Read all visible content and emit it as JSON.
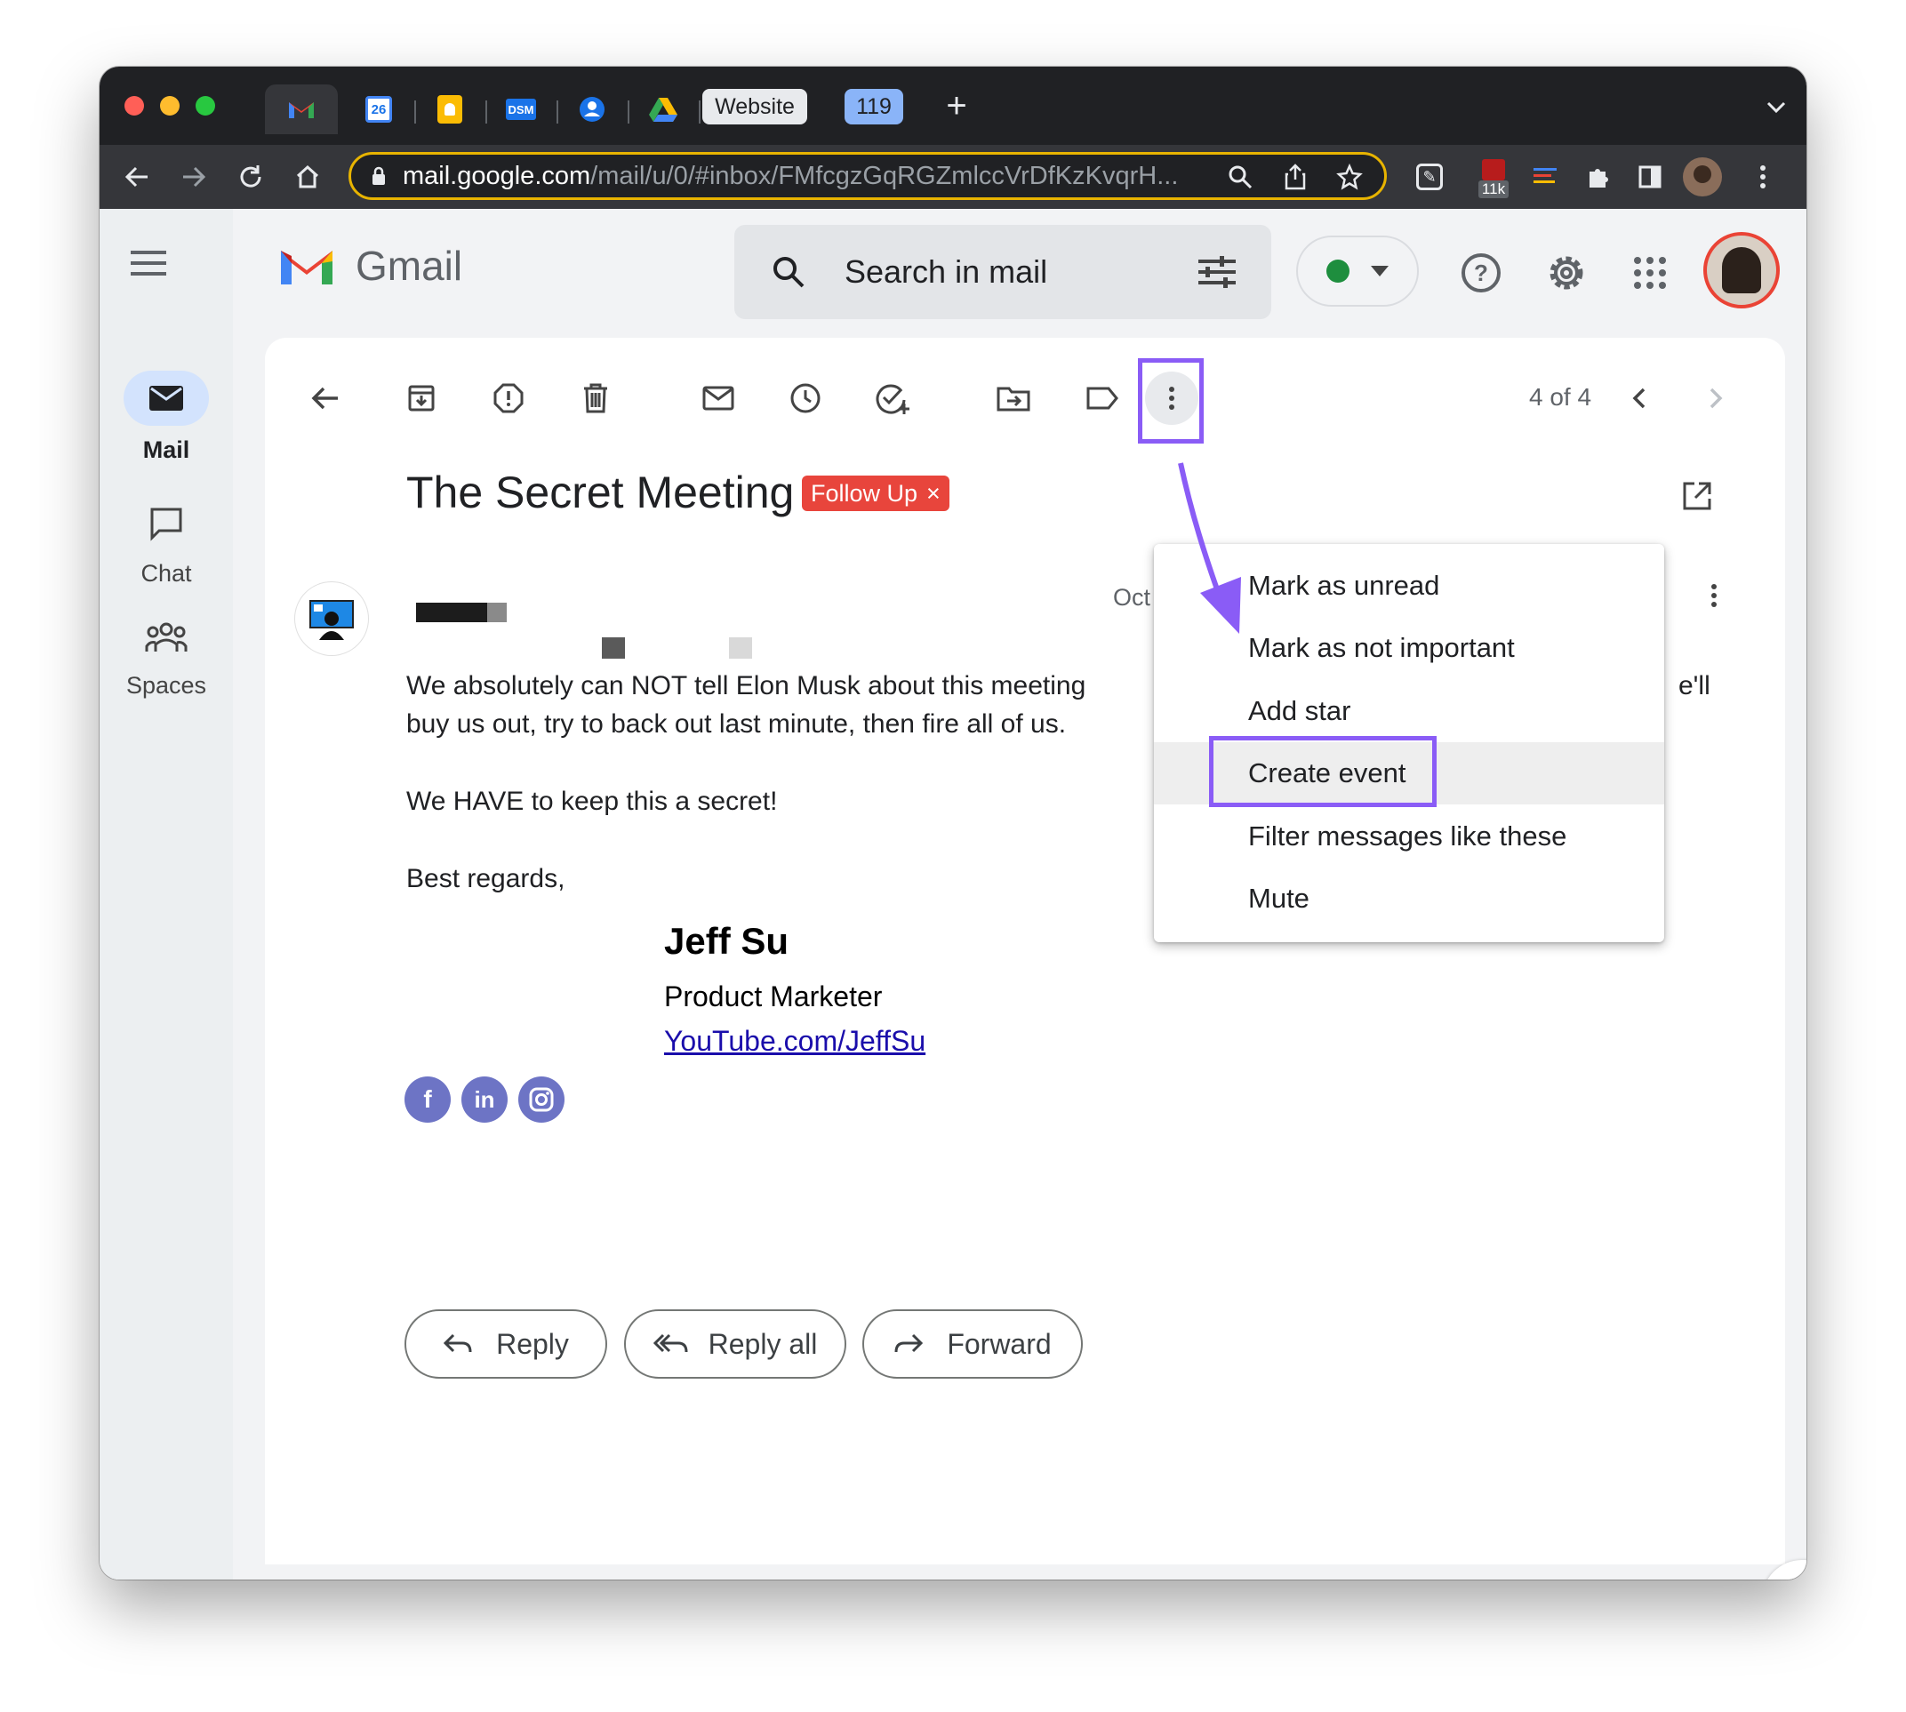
{
  "browser": {
    "tabs": [
      {
        "icon": "gmail-icon"
      },
      {
        "icon": "calendar-icon",
        "label": "26"
      },
      {
        "icon": "keep-icon"
      },
      {
        "icon": "dsm-icon",
        "label": "DSM"
      },
      {
        "icon": "contacts-icon"
      },
      {
        "icon": "drive-icon"
      }
    ],
    "tab_website": "Website",
    "tab_count": "119",
    "url_host": "mail.google.com",
    "url_path": "/mail/u/0/#inbox/FMfcgzGqRGZmlccVrDfKzKvqrH...",
    "ext_badge": "11k"
  },
  "gmail": {
    "logo_text": "Gmail",
    "search_placeholder": "Search in mail",
    "rail": [
      {
        "label": "Mail",
        "icon": "mail-icon"
      },
      {
        "label": "Chat",
        "icon": "chat-icon"
      },
      {
        "label": "Spaces",
        "icon": "spaces-icon"
      }
    ],
    "pagination": "4 of 4",
    "subject": "The Secret Meeting",
    "label_chip": "Follow Up",
    "label_chip_close": "×",
    "date_partial": "Oct",
    "body": [
      "We absolutely can NOT tell Elon Musk about this meeting",
      "buy us out, try to back out last minute, then fire all of us.",
      "We HAVE to keep this a secret!",
      "Best regards,"
    ],
    "body_overflow": "e'll",
    "signature": {
      "name": "Jeff Su",
      "title": "Product Marketer",
      "link": "YouTube.com/JeffSu",
      "social": [
        "f",
        "in",
        "ig"
      ]
    },
    "actions": {
      "reply": "Reply",
      "reply_all": "Reply all",
      "forward": "Forward"
    },
    "menu": [
      "Mark as unread",
      "Mark as not important",
      "Add star",
      "Create event",
      "Filter messages like these",
      "Mute"
    ],
    "highlighted_menu_item": "Create event",
    "colors": {
      "accent_purple": "#8a5cf6",
      "chip_red": "#e8453c",
      "status_green": "#1e8e3e",
      "link_blue": "#1a0dab"
    }
  }
}
